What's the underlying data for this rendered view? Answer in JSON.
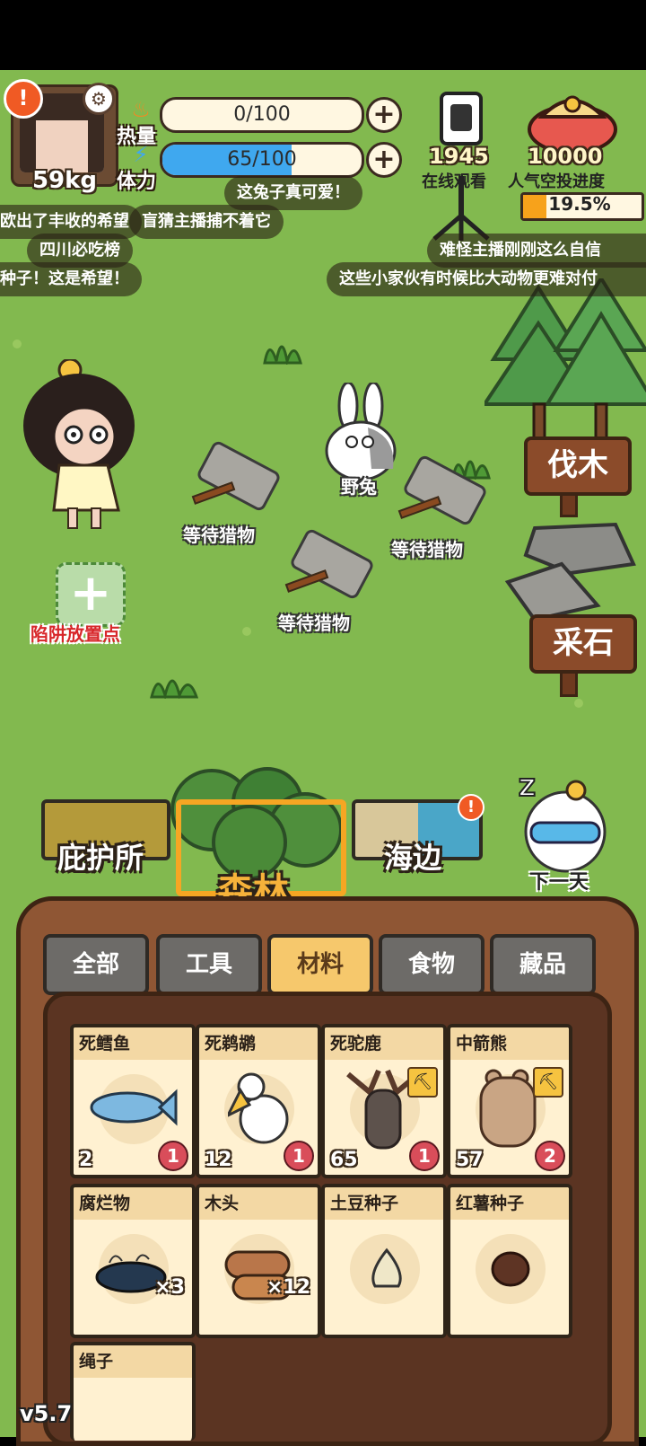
{
  "hud": {
    "weight": "59kg",
    "calories": {
      "label": "热量",
      "value": "0/100",
      "fill": 0.0
    },
    "stamina": {
      "label": "体力",
      "value": "65/100",
      "fill": 0.65
    },
    "viewers": {
      "count": "1945",
      "label": "在线观看"
    },
    "airdrop": {
      "target": "10000",
      "label": "人气空投进度",
      "percent": "19.5%",
      "fill": 0.195
    }
  },
  "danmaku": [
    "这兔子真可爱！",
    "欧出了丰收的希望",
    "盲猜主播捕不着它",
    "四川必吃榜",
    "难怪主播刚刚这么自信",
    "种子！这是希望！",
    "这些小家伙有时候比大动物更难对付"
  ],
  "field": {
    "rabbit_label": "野兔",
    "traps": [
      "等待猎物",
      "等待猎物",
      "等待猎物"
    ],
    "trap_slot_label": "陷阱放置点",
    "chop_sign": "伐木",
    "mine_sign": "采石"
  },
  "locations": {
    "shelter": "庇护所",
    "forest": "森林",
    "beach": "海边",
    "next_day": "下一天"
  },
  "categories": [
    "全部",
    "工具",
    "材料",
    "食物",
    "藏品"
  ],
  "active_category": "材料",
  "items": [
    {
      "name": "死鳕鱼",
      "left": "2",
      "right": "1",
      "icon": "fish-icon"
    },
    {
      "name": "死鹈鹕",
      "left": "12",
      "right": "1",
      "icon": "pelican-icon"
    },
    {
      "name": "死驼鹿",
      "left": "65",
      "right": "1",
      "icon": "moose-icon"
    },
    {
      "name": "中箭熊",
      "left": "57",
      "right": "2",
      "icon": "bear-icon"
    },
    {
      "name": "腐烂物",
      "mult": "×3",
      "icon": "rot-icon"
    },
    {
      "name": "木头",
      "mult": "×12",
      "icon": "log-icon"
    },
    {
      "name": "土豆种子",
      "icon": "potato-seed-icon"
    },
    {
      "name": "红薯种子",
      "icon": "sweet-potato-seed-icon"
    },
    {
      "name": "绳子",
      "icon": "rope-icon"
    }
  ],
  "version": "v5.7",
  "colors": {
    "grass": "#82b94f",
    "wood": "#8f5634",
    "accent": "#f6c86c",
    "stamina": "#3fa8ef"
  }
}
